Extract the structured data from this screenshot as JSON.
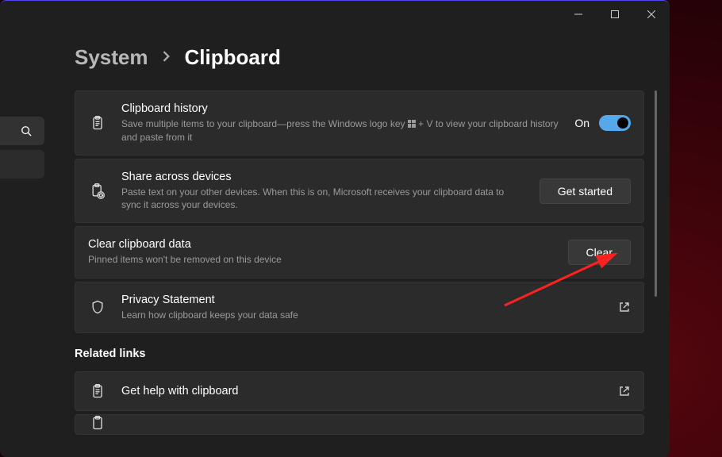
{
  "breadcrumb": {
    "parent": "System",
    "current": "Clipboard"
  },
  "cards": {
    "history": {
      "title": "Clipboard history",
      "desc_before": "Save multiple items to your clipboard—press the Windows logo key ",
      "desc_after": " + V to view your clipboard history and paste from it",
      "toggle_state": "On"
    },
    "share": {
      "title": "Share across devices",
      "desc": "Paste text on your other devices. When this is on, Microsoft receives your clipboard data to sync it across your devices.",
      "button": "Get started"
    },
    "clear": {
      "title": "Clear clipboard data",
      "desc": "Pinned items won't be removed on this device",
      "button": "Clear"
    },
    "privacy": {
      "title": "Privacy Statement",
      "desc": "Learn how clipboard keeps your data safe"
    },
    "help": {
      "title": "Get help with clipboard"
    }
  },
  "related_label": "Related links"
}
